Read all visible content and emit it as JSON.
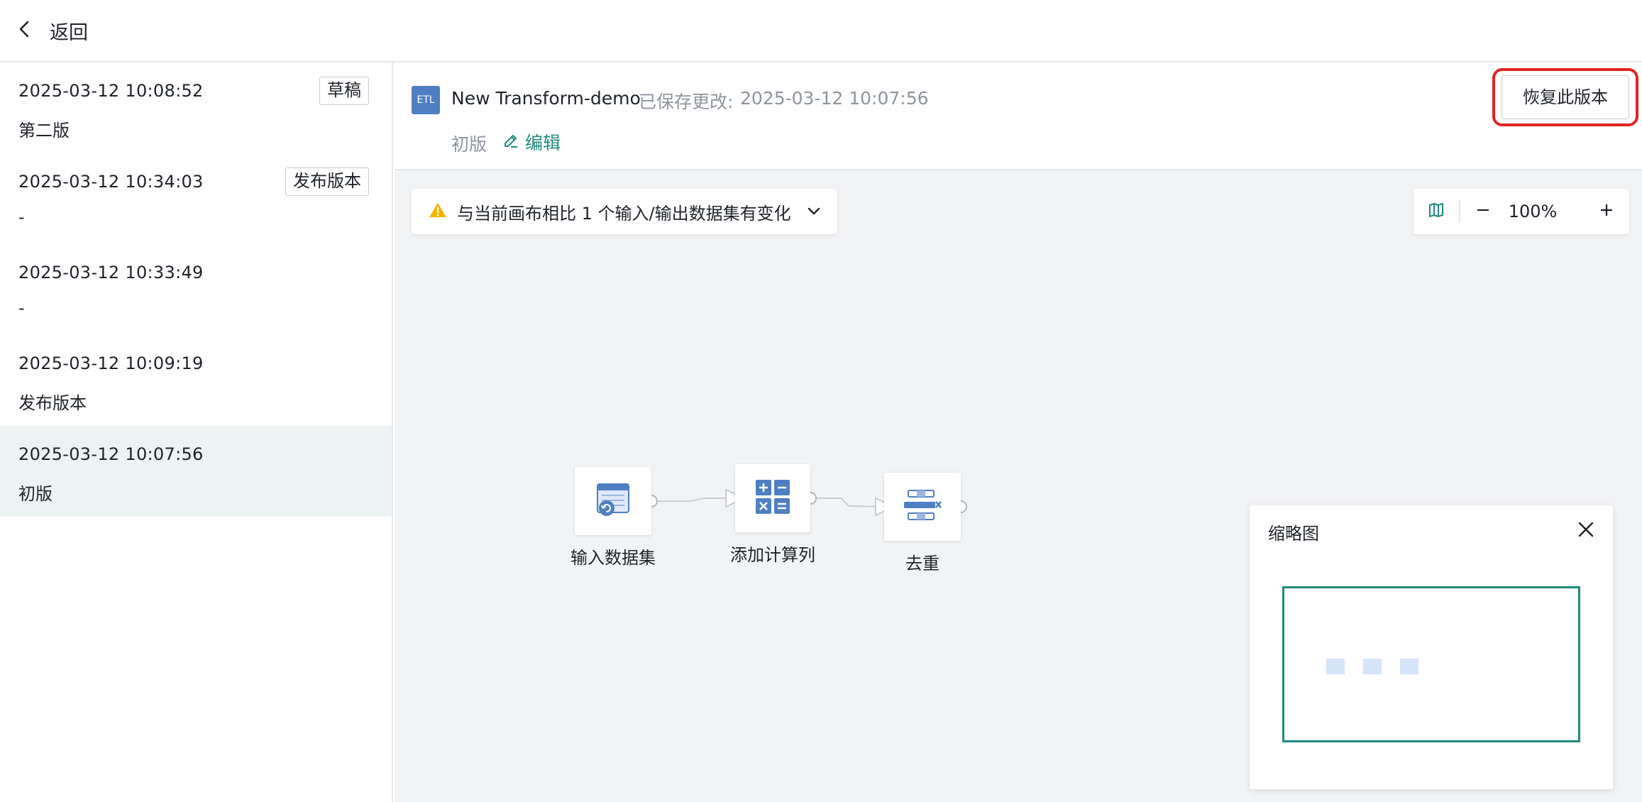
{
  "topbar": {
    "back_label": "返回",
    "back_icon": "chevron-left-icon"
  },
  "sidebar": {
    "versions": [
      {
        "timestamp": "2025-03-12 10:08:52",
        "name": "第二版",
        "tag": "草稿",
        "selected": false
      },
      {
        "timestamp": "2025-03-12 10:34:03",
        "name": "-",
        "tag": "发布版本",
        "selected": false
      },
      {
        "timestamp": "2025-03-12 10:33:49",
        "name": "-",
        "tag": "",
        "selected": false
      },
      {
        "timestamp": "2025-03-12 10:09:19",
        "name": "发布版本",
        "tag": "",
        "selected": false
      },
      {
        "timestamp": "2025-03-12 10:07:56",
        "name": "初版",
        "tag": "",
        "selected": true
      }
    ]
  },
  "header": {
    "badge": "ETL",
    "title": "New Transform-demo",
    "saved_label": "已保存更改:",
    "saved_time": "2025-03-12 10:07:56",
    "version_name": "初版",
    "edit_label": "编辑",
    "restore_label": "恢复此版本"
  },
  "notice": {
    "text": "与当前画布相比 1 个输入/输出数据集有变化",
    "icon": "warning-icon"
  },
  "zoom": {
    "level": "100%"
  },
  "flow": {
    "nodes": [
      {
        "label": "输入数据集",
        "icon": "dataset-icon"
      },
      {
        "label": "添加计算列",
        "icon": "calculator-icon"
      },
      {
        "label": "去重",
        "icon": "dedupe-icon"
      }
    ]
  },
  "minimap": {
    "title": "缩略图"
  },
  "colors": {
    "accent": "#1f8a7e",
    "highlight": "#e02424",
    "etl_badge": "#4f7fc3",
    "warning": "#f5b400"
  }
}
